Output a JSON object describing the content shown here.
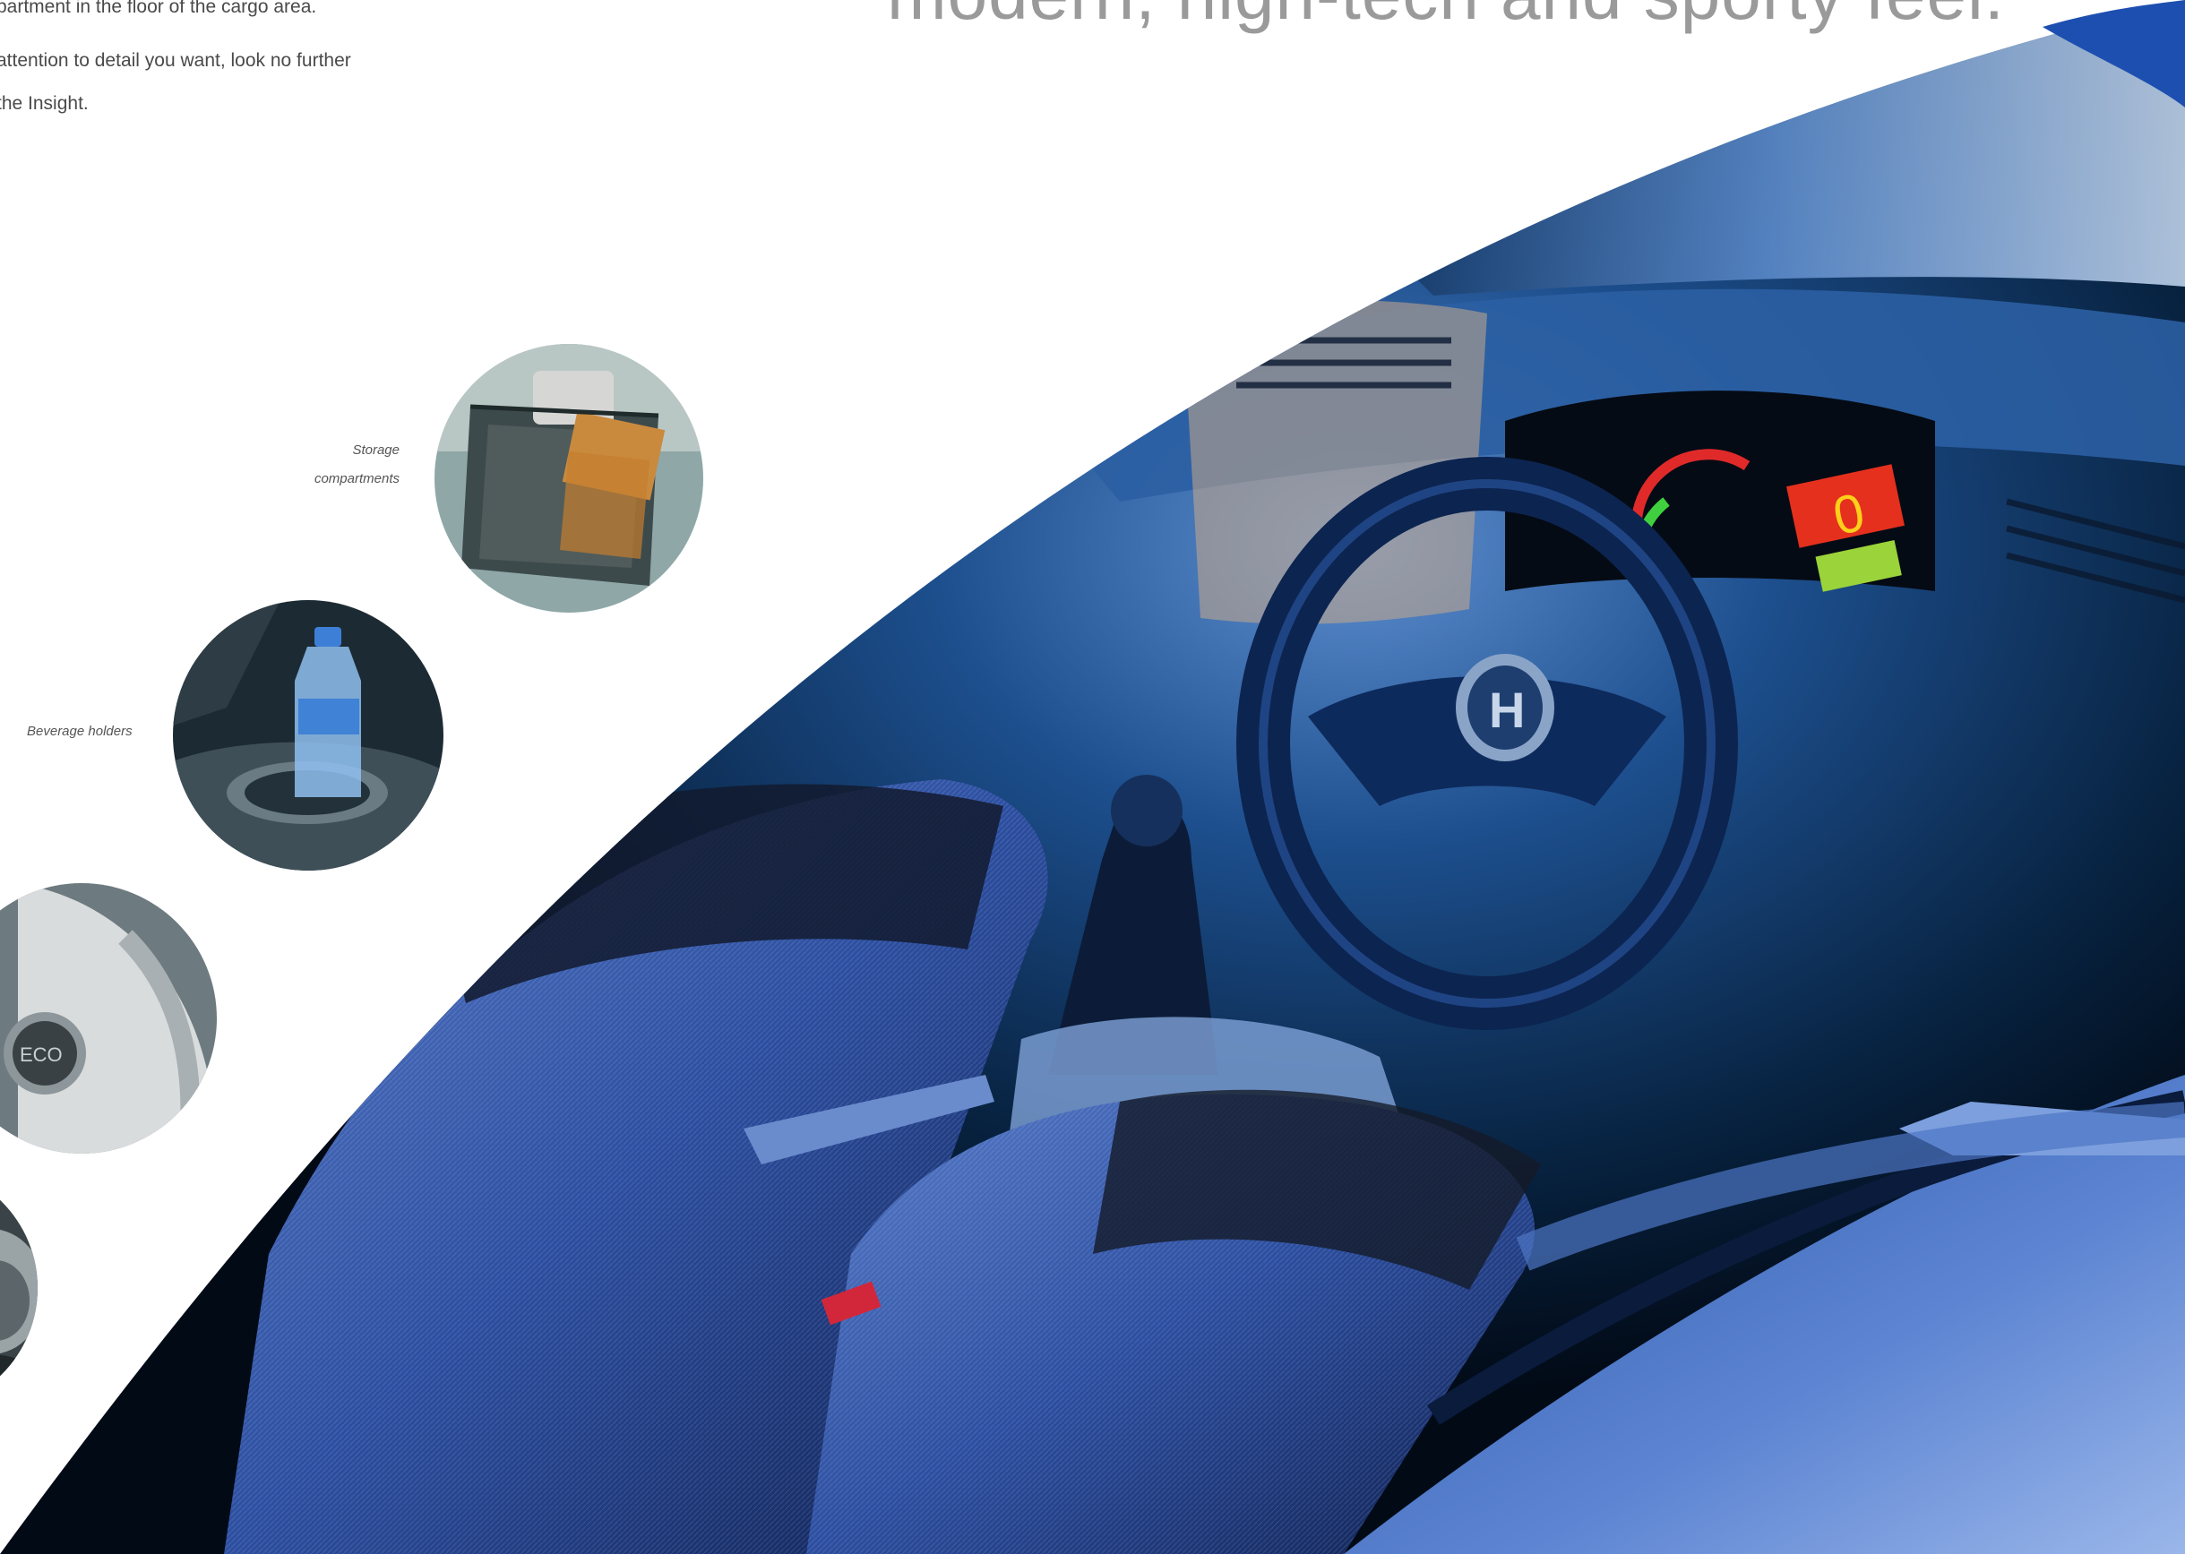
{
  "headline": "modern, high-tech and sporty feel.",
  "body_lines": [
    "partment in the floor of the cargo area.",
    "attention to detail you want, look no further",
    "the Insight."
  ],
  "captions": {
    "storage_line1": "Storage",
    "storage_line2": "compartments",
    "beverage": "Beverage holders"
  },
  "photo": {
    "badge": "H",
    "eco_button": "ECO",
    "speed_readout": "0"
  },
  "colors": {
    "headline": "#9a9a9a",
    "body_text": "#4a4a4a",
    "caption": "#555555",
    "interior_deep": "#04101e",
    "interior_blue": "#1f4f8f",
    "seat_blue": "#3b5fae",
    "body_panel": "#6d93d8"
  },
  "icons": [
    "storage-compartment-thumb",
    "beverage-holder-thumb",
    "eco-button-thumb",
    "shifter-thumb"
  ]
}
